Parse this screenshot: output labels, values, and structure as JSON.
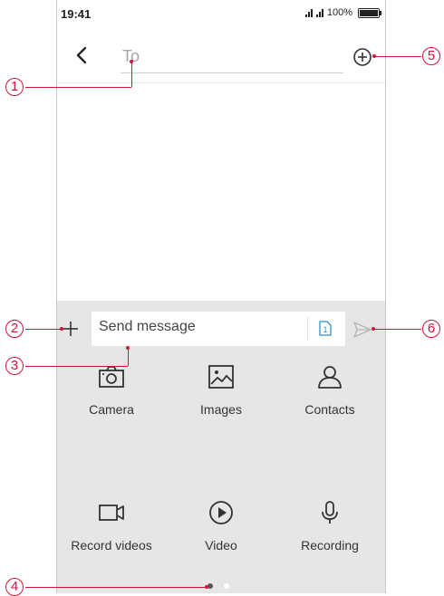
{
  "status_bar": {
    "time": "19:41",
    "battery": "100%"
  },
  "header": {
    "to_placeholder": "To"
  },
  "composer": {
    "message_placeholder": "Send message",
    "sim_label": "1"
  },
  "attachments": [
    {
      "label": "Camera",
      "icon": "camera-icon"
    },
    {
      "label": "Images",
      "icon": "image-icon"
    },
    {
      "label": "Contacts",
      "icon": "contact-icon"
    },
    {
      "label": "Record videos",
      "icon": "video-camera-icon"
    },
    {
      "label": "Video",
      "icon": "play-icon"
    },
    {
      "label": "Recording",
      "icon": "microphone-icon"
    }
  ],
  "pagination": {
    "pages": 2,
    "current": 1
  },
  "callouts": [
    "1",
    "2",
    "3",
    "4",
    "5",
    "6"
  ],
  "colors": {
    "annotation": "#d2143a",
    "tray": "#e6e6e6",
    "sim_accent": "#2a8ed4",
    "placeholder": "#a8a8a8"
  }
}
